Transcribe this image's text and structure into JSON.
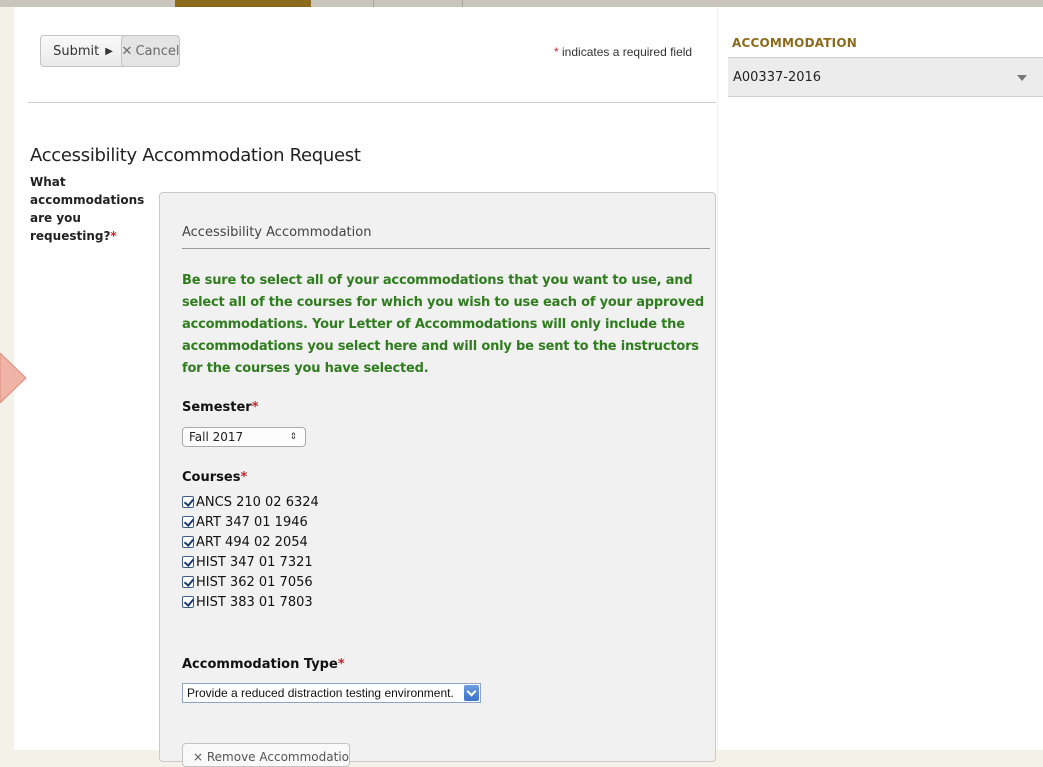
{
  "toolbar": {
    "submit_label": "Submit",
    "cancel_label": "Cancel",
    "required_note": "indicates a required field",
    "required_star": "*"
  },
  "page": {
    "title": "Accessibility Accommodation Request",
    "question": "What accommodations are you requesting?",
    "question_star": "*"
  },
  "accommodation_panel": {
    "heading": "Accessibility Accommodation",
    "instructions": "Be sure to select all of your accommodations that you want to use, and select all of the courses for which you wish to use each of your approved accommodations. Your Letter of Accommodations will only include the accommodations you select here and will only be sent to the instructors for the courses you have selected.",
    "semester_label": "Semester",
    "semester_value": "Fall 2017",
    "courses_label": "Courses",
    "courses": [
      {
        "label": "ANCS 210 02 6324",
        "checked": true
      },
      {
        "label": "ART 347 01 1946",
        "checked": true
      },
      {
        "label": "ART 494 02 2054",
        "checked": true
      },
      {
        "label": "HIST 347 01 7321",
        "checked": true
      },
      {
        "label": "HIST 362 01 7056",
        "checked": true
      },
      {
        "label": "HIST 383 01 7803",
        "checked": true
      }
    ],
    "type_label": "Accommodation Type",
    "type_value": "Provide a reduced distraction testing environment.",
    "remove_label": "× Remove Accommodation"
  },
  "sidebar": {
    "title": "ACCOMMODATION",
    "selected": "A00337-2016"
  },
  "colors": {
    "accent_gold": "#8c6a1c",
    "instruction_green": "#2f7d1e",
    "required_red": "#c0262d",
    "pointer": "#f0b4a6"
  }
}
